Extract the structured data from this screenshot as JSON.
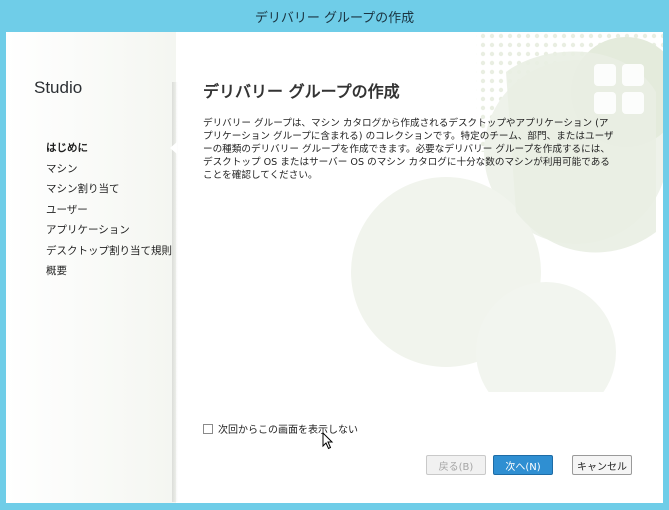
{
  "window": {
    "title": "デリバリー グループの作成"
  },
  "sidebar": {
    "brand": "Studio",
    "items": [
      {
        "label": "はじめに",
        "active": true
      },
      {
        "label": "マシン"
      },
      {
        "label": "マシン割り当て"
      },
      {
        "label": "ユーザー"
      },
      {
        "label": "アプリケーション"
      },
      {
        "label": "デスクトップ割り当て規則"
      },
      {
        "label": "概要"
      }
    ]
  },
  "main": {
    "heading": "デリバリー グループの作成",
    "description": "デリバリー グループは、マシン カタログから作成されるデスクトップやアプリケーション (アプリケーション グループに含まれる) のコレクションです。特定のチーム、部門、またはユーザーの種類のデリバリー グループを作成できます。必要なデリバリー グループを作成するには、デスクトップ OS またはサーバー OS のマシン カタログに十分な数のマシンが利用可能であることを確認してください。",
    "checkbox_label": "次回からこの画面を表示しない",
    "checkbox_checked": false
  },
  "buttons": {
    "back": "戻る(B)",
    "next": "次へ(N)",
    "cancel": "キャンセル"
  },
  "colors": {
    "titlebar": "#6fcde8",
    "primary_button": "#2f8fd2"
  }
}
